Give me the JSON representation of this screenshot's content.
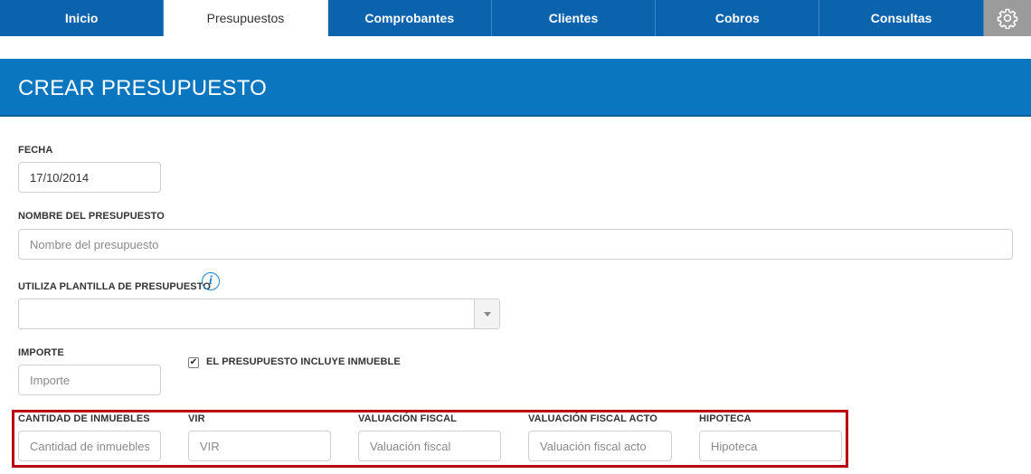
{
  "nav": {
    "tabs": [
      {
        "label": "Inicio"
      },
      {
        "label": "Presupuestos",
        "active": true
      },
      {
        "label": "Comprobantes"
      },
      {
        "label": "Clientes"
      },
      {
        "label": "Cobros"
      },
      {
        "label": "Consultas"
      }
    ],
    "settings_icon": "gear-icon"
  },
  "page": {
    "title": "CREAR PRESUPUESTO"
  },
  "form": {
    "fecha": {
      "label": "FECHA",
      "value": "17/10/2014"
    },
    "nombre": {
      "label": "NOMBRE DEL PRESUPUESTO",
      "placeholder": "Nombre del presupuesto"
    },
    "plantilla": {
      "label": "UTILIZA PLANTILLA DE PRESUPUESTO",
      "info_icon": "i",
      "selected": ""
    },
    "importe": {
      "label": "IMPORTE",
      "placeholder": "Importe"
    },
    "incluye_inmueble": {
      "label": "EL PRESUPUESTO INCLUYE INMUEBLE",
      "checked": true
    },
    "cantidad": {
      "label": "CANTIDAD DE INMUEBLES",
      "placeholder": "Cantidad de inmuebles"
    },
    "vir": {
      "label": "VIR",
      "placeholder": "VIR"
    },
    "valuacion_fiscal": {
      "label": "VALUACIÓN FISCAL",
      "placeholder": "Valuación fiscal"
    },
    "valuacion_fiscal_acto": {
      "label": "VALUACIÓN FISCAL ACTO",
      "placeholder": "Valuación fiscal acto"
    },
    "hipoteca": {
      "label": "HIPOTECA",
      "placeholder": "Hipoteca"
    }
  },
  "colors": {
    "nav_bg": "#0b63ad",
    "banner_bg": "#0b76c0",
    "highlight": "#b80012",
    "accent": "#1b7fc4"
  }
}
